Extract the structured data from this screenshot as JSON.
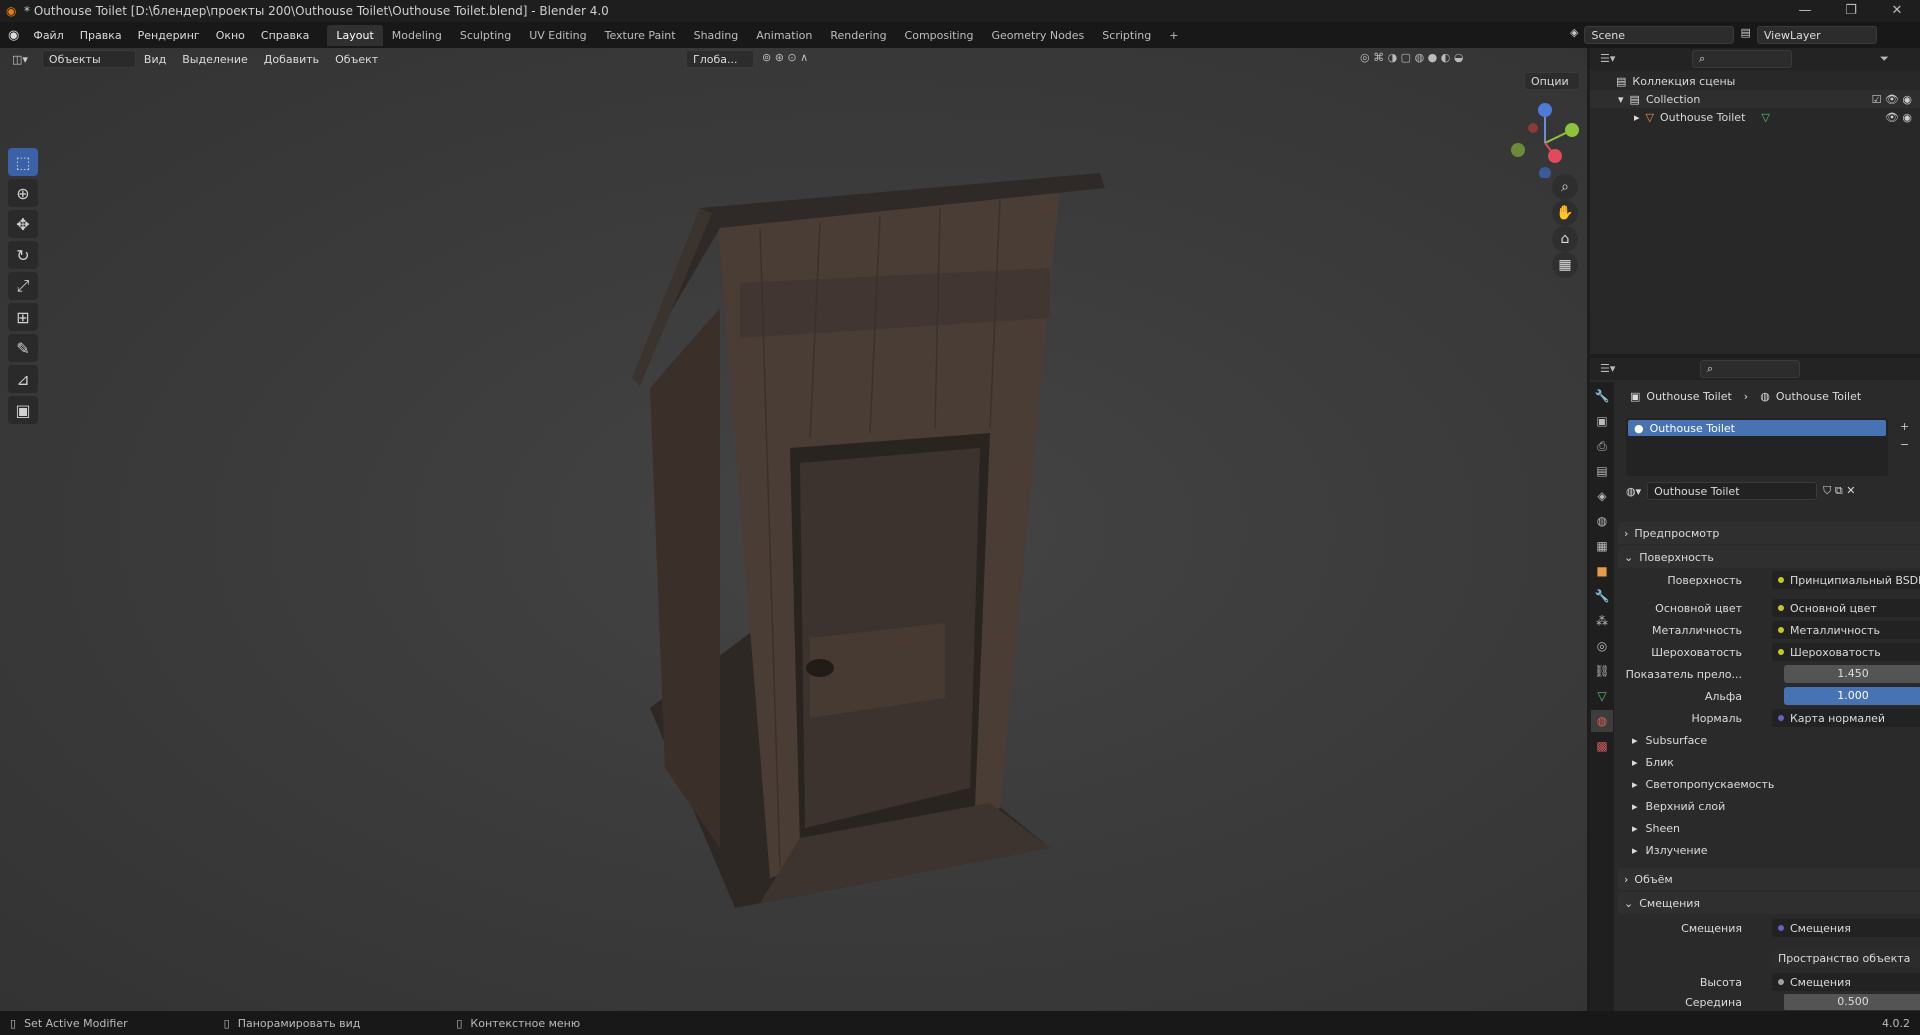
{
  "window": {
    "title": "* Outhouse Toilet [D:\\блендер\\проекты 200\\Outhouse Toilet\\Outhouse Toilet.blend] - Blender 4.0",
    "min": "—",
    "max": "❐",
    "close": "✕"
  },
  "menu": [
    "Файл",
    "Правка",
    "Рендеринг",
    "Окно",
    "Справка"
  ],
  "workspaces": [
    "Layout",
    "Modeling",
    "Sculpting",
    "UV Editing",
    "Texture Paint",
    "Shading",
    "Animation",
    "Rendering",
    "Compositing",
    "Geometry Nodes",
    "Scripting",
    "+"
  ],
  "scene": {
    "label": "Scene",
    "viewlayer": "ViewLayer"
  },
  "viewport": {
    "mode": "Объекты",
    "menus": [
      "Вид",
      "Выделение",
      "Добавить",
      "Объект"
    ],
    "orientation": "Глоба...",
    "options": "Опции"
  },
  "outliner": {
    "root": "Коллекция сцены",
    "collection": "Collection",
    "object": "Outhouse Toilet"
  },
  "props": {
    "breadcrumb_obj": "Outhouse Toilet",
    "breadcrumb_mat": "Outhouse Toilet",
    "slot": "Outhouse Toilet",
    "material_name": "Outhouse Toilet",
    "sections": {
      "preview": "Предпросмотр",
      "surface": "Поверхность",
      "volume": "Объём",
      "displacement": "Смещения"
    },
    "rows": {
      "surface_lbl": "Поверхность",
      "surface_val": "Принципиальный BSDF",
      "base_lbl": "Основной цвет",
      "base_val": "Основной цвет",
      "metal_lbl": "Металличность",
      "metal_val": "Металличность",
      "rough_lbl": "Шероховатость",
      "rough_val": "Шероховатость",
      "ior_lbl": "Показатель прело...",
      "ior_val": "1.450",
      "alpha_lbl": "Альфа",
      "alpha_val": "1.000",
      "normal_lbl": "Нормаль",
      "normal_val": "Карта нормалей",
      "subsurface": "Subsurface",
      "specular": "Блик",
      "transmission": "Светопропускаемость",
      "coat": "Верхний слой",
      "sheen": "Sheen",
      "emission": "Излучение",
      "disp_lbl": "Смещения",
      "disp_val": "Смещения",
      "space_val": "Пространство объекта",
      "height_lbl": "Высота",
      "height_val": "Смещения",
      "mid_lbl": "Середина",
      "mid_val": "0.500"
    }
  },
  "status": {
    "left": "Set Active Modifier",
    "mid": "Панорамировать вид",
    "right": "Контекстное меню",
    "version": "4.0.2"
  }
}
